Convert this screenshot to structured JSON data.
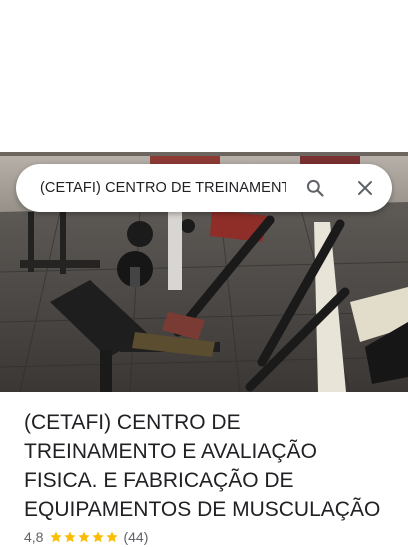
{
  "search": {
    "query": "(CETAFI) CENTRO DE TREINAMENTO E AVALIAÇÃO FISICA. E FABRICAÇÃO DE EQUIPAMENTOS DE MUSCULAÇÃO"
  },
  "place": {
    "title": "(CETAFI) CENTRO DE TREINAMENTO E AVALIAÇÃO FISICA. E FABRICAÇÃO DE EQUIPAMENTOS DE MUSCULAÇÃO",
    "rating": "4,8",
    "stars": 5,
    "review_count": "(44)"
  },
  "colors": {
    "star": "#fbbc04",
    "title_text": "#202124",
    "secondary_text": "#5f6368"
  },
  "icons": {
    "search": "search-icon",
    "close": "close-icon",
    "star": "star-icon"
  }
}
